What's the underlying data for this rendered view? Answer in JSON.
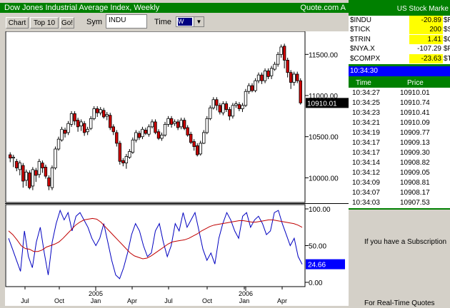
{
  "window": {
    "title": "Dow Jones Industrial Average Index, Weekly",
    "source": "Quote.com A"
  },
  "toolbar": {
    "chart_label": "Chart",
    "top10_label": "Top 10",
    "go_label": "Go!",
    "sym_label": "Sym",
    "sym_value": "INDU",
    "time_label": "Time",
    "time_value": "W"
  },
  "chart_data": [
    {
      "type": "candlestick",
      "title": "Dow Jones Industrial Average Index, Weekly",
      "xticks": [
        "Jul",
        "Oct",
        "2005",
        "Jan",
        "Apr",
        "Jul",
        "Oct",
        "2006",
        "Jan",
        "Apr"
      ],
      "yticks": [
        "11500.00",
        "11000.00",
        "10500.00",
        "10000.00"
      ],
      "ylim": [
        9700,
        11780
      ],
      "last_value": "10910.01",
      "candles": [
        [
          10280,
          10240,
          10190
        ],
        [
          10240,
          10250,
          10130
        ],
        [
          10200,
          10120,
          10080
        ],
        [
          10100,
          10180,
          10030
        ],
        [
          10150,
          9960,
          9880
        ],
        [
          9970,
          10070,
          9900
        ],
        [
          10060,
          9880,
          9860
        ],
        [
          9900,
          10100,
          9850
        ],
        [
          10090,
          10030,
          9950
        ],
        [
          10040,
          10200,
          10000
        ],
        [
          10180,
          10120,
          10060
        ],
        [
          10130,
          10020,
          9990
        ],
        [
          10000,
          9900,
          9850
        ],
        [
          9880,
          10120,
          9850
        ],
        [
          10120,
          10350,
          10100
        ],
        [
          10350,
          10470,
          10330
        ],
        [
          10460,
          10590,
          10440
        ],
        [
          10580,
          10540,
          10490
        ],
        [
          10550,
          10660,
          10520
        ],
        [
          10650,
          10780,
          10620
        ],
        [
          10780,
          10690,
          10640
        ],
        [
          10700,
          10620,
          10560
        ],
        [
          10630,
          10680,
          10570
        ],
        [
          10660,
          10550,
          10510
        ],
        [
          10560,
          10590,
          10520
        ],
        [
          10600,
          10720,
          10580
        ],
        [
          10720,
          10840,
          10700
        ],
        [
          10840,
          10790,
          10740
        ],
        [
          10790,
          10830,
          10760
        ],
        [
          10820,
          10740,
          10720
        ],
        [
          10750,
          10770,
          10700
        ],
        [
          10760,
          10610,
          10580
        ],
        [
          10620,
          10560,
          10520
        ],
        [
          10550,
          10420,
          10380
        ],
        [
          10420,
          10200,
          10160
        ],
        [
          10210,
          10180,
          10140
        ],
        [
          10180,
          10260,
          10110
        ],
        [
          10250,
          10320,
          10230
        ],
        [
          10310,
          10460,
          10290
        ],
        [
          10460,
          10550,
          10430
        ],
        [
          10540,
          10490,
          10460
        ],
        [
          10500,
          10590,
          10470
        ],
        [
          10580,
          10540,
          10520
        ],
        [
          10530,
          10620,
          10500
        ],
        [
          10620,
          10680,
          10600
        ],
        [
          10680,
          10550,
          10530
        ],
        [
          10560,
          10480,
          10460
        ],
        [
          10480,
          10520,
          10450
        ],
        [
          10520,
          10650,
          10500
        ],
        [
          10650,
          10720,
          10620
        ],
        [
          10720,
          10650,
          10610
        ],
        [
          10660,
          10680,
          10630
        ],
        [
          10680,
          10610,
          10580
        ],
        [
          10620,
          10700,
          10590
        ],
        [
          10700,
          10600,
          10580
        ],
        [
          10610,
          10520,
          10500
        ],
        [
          10530,
          10430,
          10410
        ],
        [
          10440,
          10380,
          10330
        ],
        [
          10390,
          10280,
          10260
        ],
        [
          10290,
          10420,
          10270
        ],
        [
          10420,
          10550,
          10410
        ],
        [
          10550,
          10720,
          10530
        ],
        [
          10720,
          10850,
          10700
        ],
        [
          10850,
          10950,
          10830
        ],
        [
          10950,
          10880,
          10820
        ],
        [
          10880,
          10800,
          10770
        ],
        [
          10790,
          10900,
          10760
        ],
        [
          10900,
          10830,
          10800
        ],
        [
          10830,
          10750,
          10700
        ],
        [
          10750,
          10880,
          10720
        ],
        [
          10880,
          10900,
          10850
        ],
        [
          10890,
          10840,
          10810
        ],
        [
          10840,
          10880,
          10800
        ],
        [
          10880,
          11050,
          10860
        ],
        [
          11050,
          11120,
          11020
        ],
        [
          11120,
          11060,
          11040
        ],
        [
          11060,
          11180,
          11040
        ],
        [
          11180,
          11250,
          11150
        ],
        [
          11250,
          11180,
          11140
        ],
        [
          11180,
          11300,
          11150
        ],
        [
          11300,
          11230,
          11200
        ],
        [
          11240,
          11330,
          11200
        ],
        [
          11320,
          11380,
          11300
        ],
        [
          11380,
          11500,
          11350
        ],
        [
          11500,
          11590,
          11460
        ],
        [
          11600,
          11430,
          11330
        ],
        [
          11430,
          11280,
          11220
        ],
        [
          11280,
          11160,
          11080
        ],
        [
          11160,
          11260,
          11120
        ],
        [
          11260,
          11180,
          11150
        ],
        [
          11180,
          10910,
          10890
        ]
      ]
    },
    {
      "type": "line",
      "yticks": [
        "100.00",
        "50.00",
        "0.00"
      ],
      "ylim": [
        0,
        100
      ],
      "last_value": "24.66",
      "series": [
        {
          "name": "",
          "color": "#0000c0",
          "values": [
            60,
            45,
            30,
            15,
            70,
            35,
            20,
            55,
            75,
            40,
            10,
            55,
            80,
            98,
            85,
            95,
            70,
            90,
            95,
            85,
            75,
            60,
            50,
            60,
            80,
            55,
            30,
            10,
            5,
            20,
            40,
            65,
            80,
            70,
            50,
            35,
            40,
            70,
            80,
            55,
            35,
            50,
            80,
            70,
            95,
            75,
            85,
            95,
            70,
            45,
            30,
            40,
            25,
            60,
            80,
            95,
            85,
            70,
            60,
            90,
            95,
            75,
            85,
            90,
            80,
            65,
            70,
            95,
            98,
            80,
            65,
            50,
            60,
            35,
            24.66
          ]
        },
        {
          "name": "",
          "color": "#c00000",
          "values": [
            70,
            65,
            58,
            50,
            46,
            45,
            42,
            42,
            44,
            48,
            50,
            52,
            55,
            60,
            66,
            72,
            78,
            82,
            85,
            86,
            87,
            86,
            82,
            76,
            70,
            64,
            58,
            52,
            46,
            40,
            36,
            34,
            32,
            33,
            36,
            40,
            44,
            48,
            52,
            55,
            56,
            57,
            58,
            60,
            63,
            66,
            70,
            73,
            76,
            78,
            79,
            80,
            81,
            82,
            83,
            84,
            84,
            83,
            82,
            82,
            83,
            84,
            85,
            85,
            84,
            83,
            82,
            81,
            80,
            78,
            75
          ]
        }
      ]
    }
  ],
  "panel": {
    "title": "US Stock Marke",
    "quotes": [
      {
        "sym": "$INDU",
        "chg": "-20.89",
        "sym2": "$RU",
        "hl": true
      },
      {
        "sym": "$TICK",
        "chg": "200",
        "sym2": "$SP",
        "hl": true
      },
      {
        "sym": "$TRIN",
        "chg": "1.41",
        "sym2": "$OE",
        "hl": true
      },
      {
        "sym": "$NYA.X",
        "chg": "-107.29",
        "sym2": "$PR",
        "hl": false
      },
      {
        "sym": "$COMPX",
        "chg": "-23.63",
        "sym2": "$TY",
        "hl": true
      }
    ],
    "time": "10:34:30",
    "ticks_header": {
      "time": "Time",
      "price": "Price"
    },
    "ticks": [
      {
        "time": "10:34:27",
        "price": "10910.01"
      },
      {
        "time": "10:34:25",
        "price": "10910.74"
      },
      {
        "time": "10:34:23",
        "price": "10910.41"
      },
      {
        "time": "10:34:21",
        "price": "10910.09"
      },
      {
        "time": "10:34:19",
        "price": "10909.77"
      },
      {
        "time": "10:34:17",
        "price": "10909.13"
      },
      {
        "time": "10:34:17",
        "price": "10909.30"
      },
      {
        "time": "10:34:14",
        "price": "10908.82"
      },
      {
        "time": "10:34:12",
        "price": "10909.05"
      },
      {
        "time": "10:34:09",
        "price": "10908.81"
      },
      {
        "time": "10:34:07",
        "price": "10908.17"
      },
      {
        "time": "10:34:03",
        "price": "10907.53"
      }
    ],
    "message1": "If you have a Subscription",
    "message2": "For Real-Time Quotes"
  }
}
